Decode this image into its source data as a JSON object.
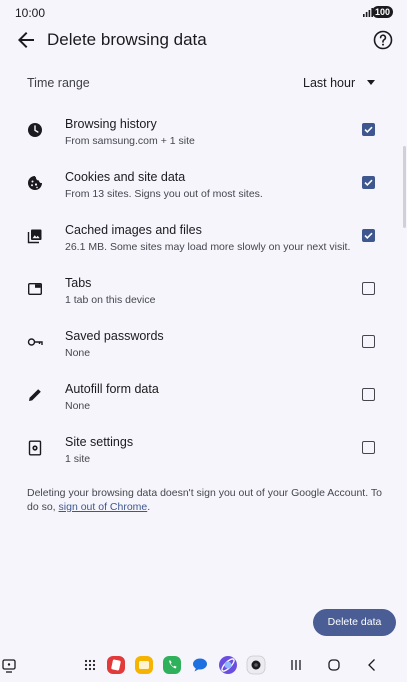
{
  "status_bar": {
    "time": "10:00",
    "battery": "100"
  },
  "app_bar": {
    "title": "Delete browsing data",
    "back_icon": "arrow-back-icon",
    "help_icon": "help-circle-icon"
  },
  "time_range": {
    "label": "Time range",
    "value": "Last hour"
  },
  "options": [
    {
      "title": "Browsing history",
      "subtitle": "From samsung.com + 1 site",
      "checked": true,
      "icon": "clock-icon"
    },
    {
      "title": "Cookies and site data",
      "subtitle": "From 13 sites. Signs you out of most sites.",
      "checked": true,
      "icon": "cookie-icon"
    },
    {
      "title": "Cached images and files",
      "subtitle": "26.1 MB. Some sites may load more slowly on your next visit.",
      "checked": true,
      "icon": "image-icon"
    },
    {
      "title": "Tabs",
      "subtitle": "1 tab on this device",
      "checked": false,
      "icon": "tab-icon"
    },
    {
      "title": "Saved passwords",
      "subtitle": "None",
      "checked": false,
      "icon": "key-icon"
    },
    {
      "title": "Autofill form data",
      "subtitle": "None",
      "checked": false,
      "icon": "pencil-icon"
    },
    {
      "title": "Site settings",
      "subtitle": "1 site",
      "checked": false,
      "icon": "site-settings-icon"
    }
  ],
  "footer": {
    "text": "Deleting your browsing data doesn't sign you out of your Google Account. To do so,",
    "link": "sign out of Chrome",
    "after_link": "."
  },
  "delete_button": {
    "label": "Delete data"
  },
  "colors": {
    "accent": "#3f578f",
    "button": "#4a5d95",
    "background": "#f6f5fb"
  },
  "taskbar": {
    "apps": [
      "app-drawer-icon",
      "gallery-app-icon",
      "files-app-icon",
      "phone-app-icon",
      "messages-app-icon",
      "internet-app-icon",
      "camera-app-icon"
    ],
    "nav": [
      "recents-icon",
      "home-icon",
      "back-nav-icon"
    ]
  }
}
